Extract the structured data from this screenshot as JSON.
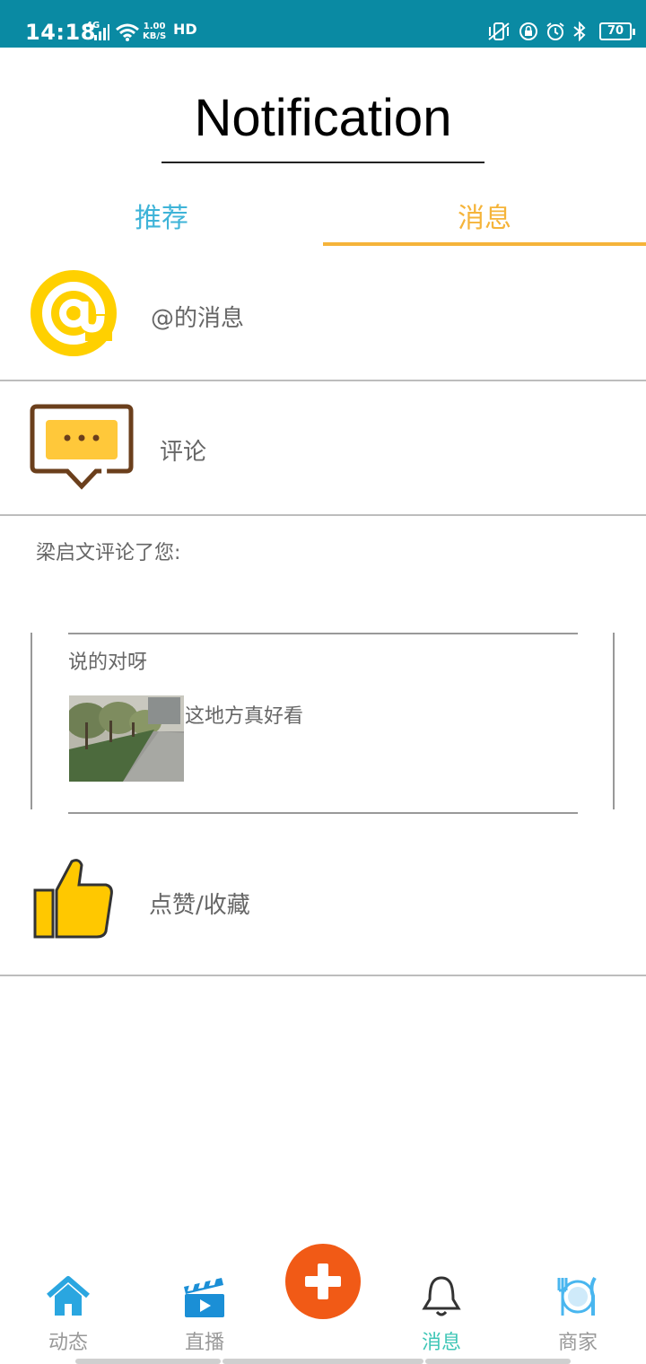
{
  "status_bar": {
    "time": "14:18",
    "network": "4G",
    "speed_value": "1.00",
    "speed_unit": "KB/S",
    "hd": "HD",
    "battery": "70"
  },
  "header": {
    "title": "Notification"
  },
  "tabs": [
    {
      "label": "推荐",
      "active": false
    },
    {
      "label": "消息",
      "active": true
    }
  ],
  "rows": {
    "mentions": {
      "label": "@的消息",
      "icon": "at-icon"
    },
    "comments": {
      "label": "评论",
      "icon": "chat-bubble-icon"
    },
    "likes": {
      "label": "点赞/收藏",
      "icon": "thumbs-up-icon"
    }
  },
  "comment_notice": {
    "author_line": "梁启文评论了您:",
    "comment_text": "说的对呀",
    "post_text": "这地方真好看",
    "post_thumbnail": "street-trees-photo"
  },
  "bottom_nav": [
    {
      "label": "动态",
      "icon": "home-icon",
      "active": false
    },
    {
      "label": "直播",
      "icon": "clapperboard-icon",
      "active": false
    },
    {
      "label": "",
      "icon": "plus-icon",
      "active": false
    },
    {
      "label": "消息",
      "icon": "bell-icon",
      "active": true
    },
    {
      "label": "商家",
      "icon": "dining-icon",
      "active": false
    }
  ],
  "colors": {
    "status_bar": "#0a8aa3",
    "tab_recommend": "#3fb4d8",
    "tab_active": "#f5b43a",
    "fab": "#f15a16",
    "nav_active": "#3ec6b6",
    "icon_yellow": "#ffd000"
  }
}
